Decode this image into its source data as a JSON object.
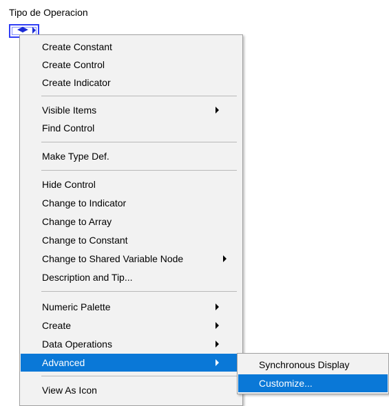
{
  "control": {
    "label": "Tipo de Operacion",
    "glyph": "◀▶"
  },
  "menu": {
    "items": [
      {
        "label": "Create Constant"
      },
      {
        "label": "Create Control"
      },
      {
        "label": "Create Indicator"
      },
      {
        "label": "Visible Items"
      },
      {
        "label": "Find Control"
      },
      {
        "label": "Make Type Def."
      },
      {
        "label": "Hide Control"
      },
      {
        "label": "Change to Indicator"
      },
      {
        "label": "Change to Array"
      },
      {
        "label": "Change to Constant"
      },
      {
        "label": "Change to Shared Variable Node"
      },
      {
        "label": "Description and Tip..."
      },
      {
        "label": "Numeric Palette"
      },
      {
        "label": "Create"
      },
      {
        "label": "Data Operations"
      },
      {
        "label": "Advanced"
      },
      {
        "label": "View As Icon"
      }
    ]
  },
  "submenu": {
    "items": [
      {
        "label": "Synchronous Display"
      },
      {
        "label": "Customize..."
      }
    ]
  },
  "colors": {
    "highlight": "#0a78d7",
    "menu_bg": "#f2f2f2",
    "control_border": "#2f3df5"
  }
}
